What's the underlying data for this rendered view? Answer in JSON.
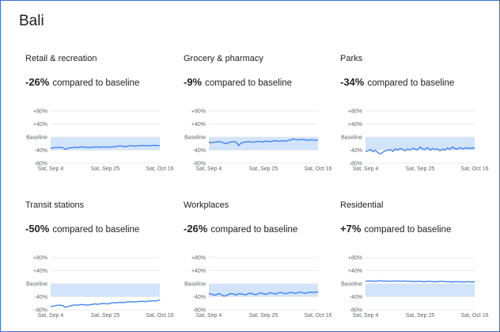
{
  "region": "Bali",
  "compare_label": "compared to baseline",
  "colors": {
    "band": "#d2e3fc",
    "line": "#4285f4",
    "grid": "#e8eaed",
    "axis": "#5f6368",
    "frame": "#3c6fd3"
  },
  "chart_data": [
    {
      "type": "line",
      "title": "Retail & recreation",
      "change": "-26%",
      "y_ticks": [
        "+80%",
        "+40%",
        "Baseline",
        "-40%",
        "-80%"
      ],
      "y_tick_values": [
        80,
        40,
        0,
        -40,
        -80
      ],
      "ylim": [
        -80,
        80
      ],
      "x_ticks": [
        "Sat, Sep 4",
        "Sat, Sep 25",
        "Sat, Oct 16"
      ],
      "values": [
        -34,
        -33,
        -32,
        -32,
        -31,
        -33,
        -38,
        -34,
        -33,
        -32,
        -31,
        -32,
        -30,
        -30,
        -31,
        -31,
        -32,
        -31,
        -30,
        -30,
        -31,
        -30,
        -30,
        -31,
        -30,
        -30,
        -29,
        -28,
        -27,
        -28,
        -29,
        -28,
        -26,
        -27,
        -28,
        -27,
        -26,
        -26,
        -26,
        -27,
        -26,
        -26,
        -25,
        -26,
        -26
      ]
    },
    {
      "type": "line",
      "title": "Grocery & pharmacy",
      "change": "-9%",
      "y_ticks": [
        "+80%",
        "+40%",
        "Baseline",
        "-40%",
        "-80%"
      ],
      "y_tick_values": [
        80,
        40,
        0,
        -40,
        -80
      ],
      "ylim": [
        -80,
        80
      ],
      "x_ticks": [
        "Sat, Sep 4",
        "Sat, Sep 25",
        "Sat, Oct 16"
      ],
      "values": [
        -16,
        -17,
        -16,
        -15,
        -14,
        -15,
        -18,
        -20,
        -17,
        -15,
        -14,
        -15,
        -26,
        -18,
        -16,
        -15,
        -14,
        -15,
        -16,
        -14,
        -13,
        -14,
        -15,
        -12,
        -13,
        -14,
        -12,
        -11,
        -13,
        -12,
        -11,
        -13,
        -10,
        -9,
        -5,
        -8,
        -9,
        -7,
        -8,
        -9,
        -10,
        -8,
        -9,
        -10,
        -9
      ]
    },
    {
      "type": "line",
      "title": "Parks",
      "change": "-34%",
      "y_ticks": [
        "+80%",
        "+40%",
        "Baseline",
        "-40%",
        "-80%"
      ],
      "y_tick_values": [
        80,
        40,
        0,
        -40,
        -80
      ],
      "ylim": [
        -80,
        80
      ],
      "x_ticks": [
        "Sat, Sep 4",
        "Sat, Sep 25",
        "Sat, Oct 16"
      ],
      "values": [
        -44,
        -42,
        -38,
        -45,
        -40,
        -48,
        -52,
        -46,
        -42,
        -40,
        -38,
        -44,
        -36,
        -40,
        -35,
        -38,
        -42,
        -36,
        -40,
        -34,
        -37,
        -39,
        -30,
        -36,
        -38,
        -32,
        -40,
        -35,
        -38,
        -36,
        -42,
        -37,
        -40,
        -33,
        -38,
        -30,
        -35,
        -37,
        -32,
        -36,
        -34,
        -33,
        -35,
        -34,
        -34
      ]
    },
    {
      "type": "line",
      "title": "Transit stations",
      "change": "-50%",
      "y_ticks": [
        "+80%",
        "+40%",
        "Baseline",
        "-40%",
        "-80%"
      ],
      "y_tick_values": [
        80,
        40,
        0,
        -40,
        -80
      ],
      "ylim": [
        -80,
        80
      ],
      "x_ticks": [
        "Sat, Sep 4",
        "Sat, Sep 25",
        "Sat, Oct 16"
      ],
      "values": [
        -70,
        -69,
        -67,
        -66,
        -66,
        -68,
        -72,
        -70,
        -68,
        -66,
        -65,
        -66,
        -64,
        -64,
        -65,
        -66,
        -64,
        -63,
        -62,
        -63,
        -62,
        -60,
        -61,
        -62,
        -60,
        -58,
        -59,
        -58,
        -57,
        -58,
        -57,
        -56,
        -55,
        -56,
        -56,
        -55,
        -54,
        -54,
        -55,
        -54,
        -53,
        -52,
        -53,
        -52,
        -50
      ]
    },
    {
      "type": "line",
      "title": "Workplaces",
      "change": "-26%",
      "y_ticks": [
        "+80%",
        "+40%",
        "Baseline",
        "-40%",
        "-80%"
      ],
      "y_tick_values": [
        80,
        40,
        0,
        -40,
        -80
      ],
      "ylim": [
        -80,
        80
      ],
      "x_ticks": [
        "Sat, Sep 4",
        "Sat, Sep 25",
        "Sat, Oct 16"
      ],
      "values": [
        -30,
        -32,
        -35,
        -34,
        -30,
        -33,
        -38,
        -36,
        -32,
        -30,
        -32,
        -35,
        -30,
        -31,
        -33,
        -34,
        -30,
        -29,
        -32,
        -34,
        -30,
        -28,
        -31,
        -33,
        -29,
        -28,
        -30,
        -32,
        -28,
        -27,
        -29,
        -31,
        -28,
        -27,
        -28,
        -30,
        -27,
        -26,
        -28,
        -29,
        -27,
        -26,
        -27,
        -26,
        -26
      ]
    },
    {
      "type": "line",
      "title": "Residential",
      "change": "+7%",
      "y_ticks": [
        "+80%",
        "+40%",
        "Baseline",
        "-40%",
        "-80%"
      ],
      "y_tick_values": [
        80,
        40,
        0,
        -40,
        -80
      ],
      "ylim": [
        -80,
        80
      ],
      "x_ticks": [
        "Sat, Sep 4",
        "Sat, Sep 25",
        "Sat, Oct 16"
      ],
      "values": [
        7,
        8,
        8,
        8,
        7,
        8,
        9,
        8,
        8,
        8,
        7,
        8,
        8,
        8,
        7,
        8,
        8,
        7,
        7,
        7,
        6,
        7,
        7,
        6,
        6,
        7,
        7,
        6,
        6,
        6,
        7,
        7,
        6,
        6,
        6,
        5,
        6,
        6,
        6,
        5,
        5,
        6,
        6,
        5,
        6
      ]
    }
  ]
}
